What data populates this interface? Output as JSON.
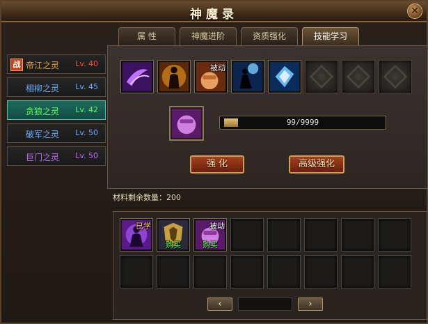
{
  "window": {
    "title": "神魔录",
    "close_label": "✕"
  },
  "tabs": [
    {
      "label": "属  性",
      "active": false
    },
    {
      "label": "神魔进阶",
      "active": false
    },
    {
      "label": "资质强化",
      "active": false
    },
    {
      "label": "技能学习",
      "active": true
    }
  ],
  "spirits": [
    {
      "badge": "战",
      "name": "帝江之灵",
      "level": "Lv. 40",
      "name_color": "#e8a23a",
      "level_color": "#ff4a3a",
      "active": false
    },
    {
      "name": "相柳之灵",
      "level": "Lv. 45",
      "name_color": "#6ab0ff",
      "level_color": "#6ab0ff",
      "active": false
    },
    {
      "name": "贪狼之灵",
      "level": "Lv. 42",
      "name_color": "#5cff5c",
      "level_color": "#5cff5c",
      "active": true
    },
    {
      "name": "破军之灵",
      "level": "Lv. 50",
      "name_color": "#6ab0ff",
      "level_color": "#6ab0ff",
      "active": false
    },
    {
      "name": "巨门之灵",
      "level": "Lv. 50",
      "name_color": "#c466ff",
      "level_color": "#c466ff",
      "active": false
    }
  ],
  "skill_slots": [
    {
      "icon": "purple-slash-icon",
      "tag": ""
    },
    {
      "icon": "golden-figure-icon",
      "tag": ""
    },
    {
      "icon": "fist-icon",
      "tag": "被动"
    },
    {
      "icon": "shadow-figure-icon",
      "tag": ""
    },
    {
      "icon": "ice-crystal-icon",
      "tag": ""
    },
    {
      "icon": "locked-slot-icon",
      "tag": ""
    },
    {
      "icon": "locked-slot-icon",
      "tag": ""
    },
    {
      "icon": "locked-slot-icon",
      "tag": ""
    }
  ],
  "selected_skill": {
    "icon": "purple-fist-icon"
  },
  "progress": {
    "text": "99/9999",
    "fraction": 0.0099
  },
  "buttons": {
    "enhance": "强  化",
    "advanced": "高级强化"
  },
  "materials": {
    "label": "材料剩余数量：200"
  },
  "inventory": [
    {
      "icon": "purple-figure-icon",
      "tag": "已学",
      "buy": ""
    },
    {
      "icon": "golden-armor-icon",
      "tag": "",
      "buy": "购买"
    },
    {
      "icon": "purple-fist-icon",
      "tag": "被动",
      "buy": "购买"
    }
  ],
  "pager": {
    "prev": "‹",
    "next": "›"
  }
}
